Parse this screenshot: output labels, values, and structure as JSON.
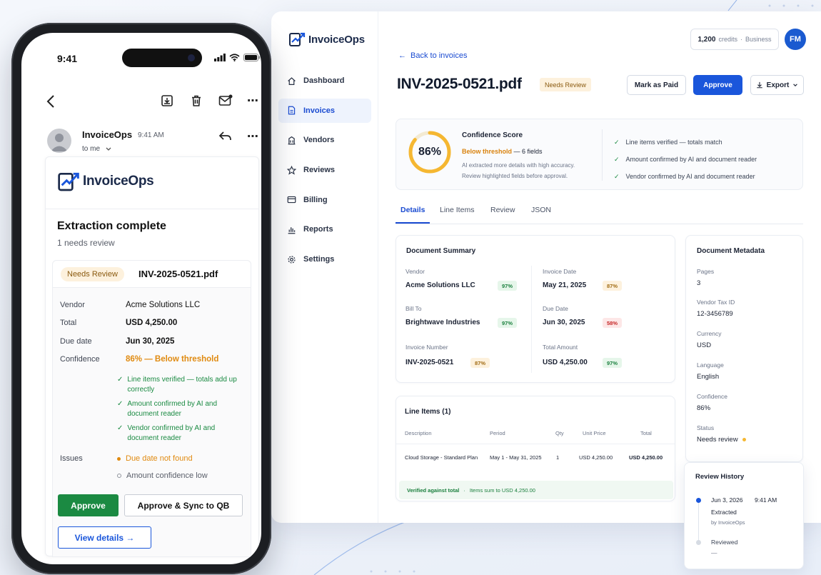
{
  "brand": {
    "name": "InvoiceOps"
  },
  "sidebar": {
    "items": [
      {
        "label": "Dashboard",
        "icon": "home-icon"
      },
      {
        "label": "Invoices",
        "icon": "document-icon",
        "active": true
      },
      {
        "label": "Vendors",
        "icon": "building-icon"
      },
      {
        "label": "Reviews",
        "icon": "star-icon"
      },
      {
        "label": "Billing",
        "icon": "card-icon"
      },
      {
        "label": "Reports",
        "icon": "bar-chart-icon"
      },
      {
        "label": "Settings",
        "icon": "gear-icon"
      }
    ]
  },
  "header": {
    "credits": "1,200",
    "credits_unit": "credits",
    "plan": "Business",
    "avatar_initials": "FM",
    "back_link": "Back to invoices",
    "title": "INV-2025-0521.pdf",
    "status_badge": "Needs Review",
    "mark_paid": "Mark as Paid",
    "approve": "Approve",
    "export": "Export"
  },
  "confidence": {
    "score": "86%",
    "score_value": 0.86,
    "title": "Confidence Score",
    "threshold_label": "Below threshold",
    "threshold_fields": "— 6 fields",
    "note_line1": "AI extracted more details with high accuracy.",
    "note_line2": "Review highlighted fields before approval.",
    "checks": [
      "Line items verified — totals match",
      "Amount confirmed by AI and document reader",
      "Vendor confirmed by AI and document reader"
    ]
  },
  "tabs": [
    "Details",
    "Line Items",
    "Review",
    "JSON"
  ],
  "summary": {
    "title": "Document Summary",
    "vendor_label": "Vendor",
    "vendor": "Acme Solutions LLC",
    "vendor_pct": "97%",
    "billto_label": "Bill To",
    "billto": "Brightwave Industries",
    "billto_pct": "97%",
    "invnum_label": "Invoice Number",
    "invnum": "INV-2025-0521",
    "invnum_pct": "87%",
    "invdate_label": "Invoice Date",
    "invdate": "May 21, 2025",
    "invdate_pct": "87%",
    "duedate_label": "Due Date",
    "duedate": "Jun 30, 2025",
    "duedate_pct": "58%",
    "total_label": "Total Amount",
    "total": "USD 4,250.00",
    "total_pct": "97%"
  },
  "line_items": {
    "title": "Line Items (1)",
    "headers": [
      "Description",
      "Period",
      "Qty",
      "Unit Price",
      "Total"
    ],
    "rows": [
      [
        "Cloud Storage - Standard Plan",
        "May 1 - May 31, 2025",
        "1",
        "USD 4,250.00",
        "USD 4,250.00"
      ]
    ],
    "verified": "Verified against total",
    "verified_note": "Items sum to USD 4,250.00"
  },
  "metadata": {
    "title": "Document Metadata",
    "fields": [
      {
        "label": "Pages",
        "value": "3"
      },
      {
        "label": "Vendor Tax ID",
        "value": "12-3456789"
      },
      {
        "label": "Currency",
        "value": "USD"
      },
      {
        "label": "Language",
        "value": "English"
      },
      {
        "label": "Confidence",
        "value": "86%"
      },
      {
        "label": "Status",
        "value": "Needs review"
      }
    ]
  },
  "history": {
    "title": "Review History",
    "events": [
      {
        "date": "Jun 3, 2026",
        "time": "9:41 AM",
        "action": "Extracted",
        "by": "by InvoiceOps"
      },
      {
        "action": "Reviewed",
        "by": "—"
      }
    ]
  },
  "phone": {
    "time": "9:41",
    "sender": "InvoiceOps",
    "sent_time": "9:41 AM",
    "to": "to me",
    "email_title": "Extraction complete",
    "email_sub": "1 needs review",
    "badge": "Needs Review",
    "file": "INV-2025-0521.pdf",
    "rows": [
      {
        "label": "Vendor",
        "value": "Acme Solutions LLC"
      },
      {
        "label": "Total",
        "value": "USD 4,250.00"
      },
      {
        "label": "Due date",
        "value": "Jun 30, 2025"
      },
      {
        "label": "Confidence",
        "value": "86% — Below threshold"
      }
    ],
    "checks": [
      "Line items verified — totals add up correctly",
      "Amount confirmed by AI and document reader",
      "Vendor confirmed by AI and document reader"
    ],
    "issues_label": "Issues",
    "issues": [
      "Due date not found",
      "Amount confidence low"
    ],
    "approve": "Approve",
    "approve_sync": "Approve & Sync to QB",
    "view_details": "View details →"
  },
  "colors": {
    "primary": "#1a56db",
    "warning": "#e08a10",
    "success": "#1a8a42",
    "ring": "#f5b731"
  }
}
